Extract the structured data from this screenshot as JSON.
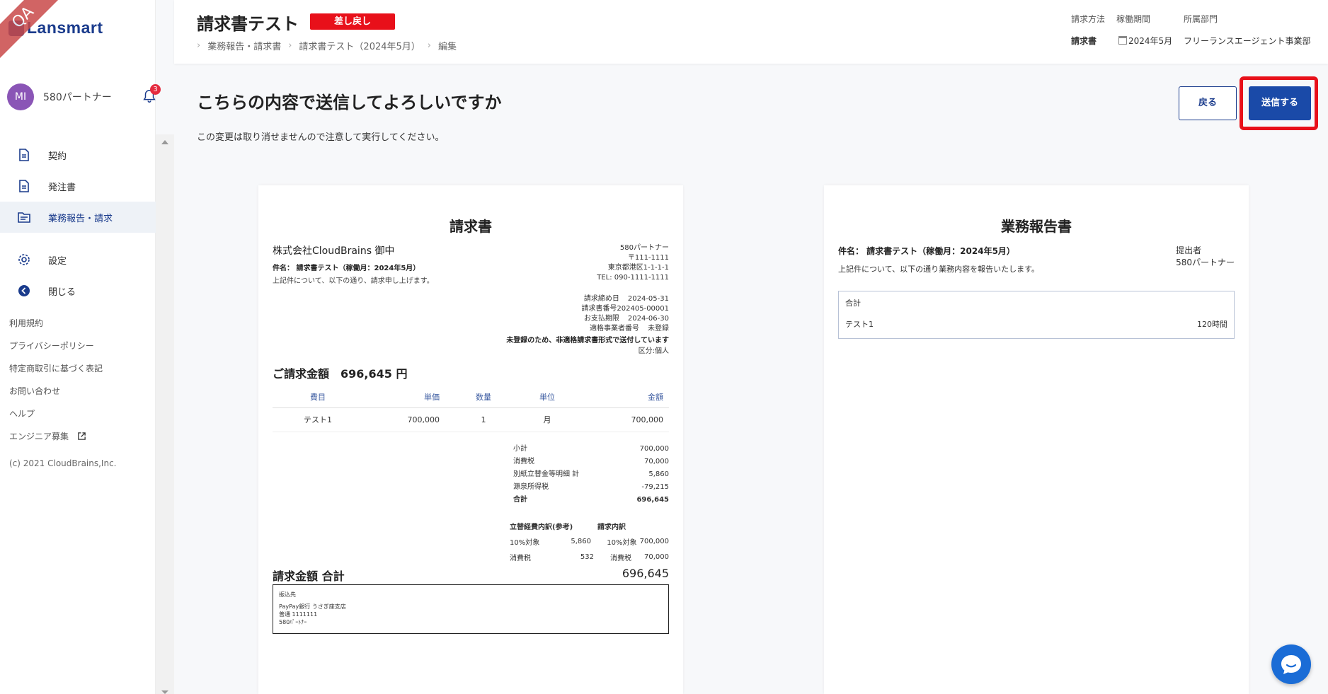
{
  "qa_ribbon": "QA",
  "logo": {
    "text": "Lansmart"
  },
  "user": {
    "initials": "MI",
    "name": "580パートナー",
    "notification_count": "3"
  },
  "sidebar": {
    "items": [
      {
        "label": "契約"
      },
      {
        "label": "発注書"
      },
      {
        "label": "業務報告・請求"
      },
      {
        "label": "設定"
      },
      {
        "label": "閉じる"
      }
    ],
    "footer_links": [
      "利用規約",
      "プライバシーポリシー",
      "特定商取引に基づく表記",
      "お問い合わせ",
      "ヘルプ",
      "エンジニア募集"
    ],
    "copyright": "(c) 2021 CloudBrains,Inc."
  },
  "header": {
    "title": "請求書テスト",
    "status": "差し戻し",
    "breadcrumb": [
      "業務報告・請求書",
      "請求書テスト（2024年5月）",
      "編集"
    ],
    "meta": {
      "billing_method_label": "請求方法",
      "billing_method_value": "請求書",
      "period_label": "稼働期間",
      "period_value": "2024年5月",
      "department_label": "所属部門",
      "department_value": "フリーランスエージェント事業部"
    }
  },
  "main": {
    "confirm_title": "こちらの内容で送信してよろしいですか",
    "confirm_note": "この変更は取り消せませんので注意して実行してください。",
    "back_label": "戻る",
    "send_label": "送信する"
  },
  "invoice": {
    "title": "請求書",
    "client": "株式会社CloudBrains 御中",
    "subject": "件名： 請求書テスト（稼働月：2024年5月）",
    "lead": "上記件について、以下の通り、請求申し上げます。",
    "issuer": [
      "580パートナー",
      "〒111-1111",
      "東京都港区1-1-1-1",
      "TEL: 090-1111-1111"
    ],
    "dates": [
      {
        "label": "請求締め日",
        "value": "2024-05-31"
      },
      {
        "label": "請求書番号",
        "value": "202405-00001"
      },
      {
        "label": "お支払期限",
        "value": "2024-06-30"
      },
      {
        "label": "適格事業者番号",
        "value": "未登録"
      }
    ],
    "unregistered_note": "未登録のため、非適格請求書形式で送付しています",
    "kubun": "区分:個人",
    "total_label": "ご請求金額",
    "total_amount": "696,645 円",
    "table": {
      "headers": [
        "費目",
        "単価",
        "数量",
        "単位",
        "金額"
      ],
      "rows": [
        [
          "テスト1",
          "700,000",
          "1",
          "月",
          "700,000"
        ]
      ]
    },
    "sums": [
      {
        "label": "小計",
        "value": "700,000"
      },
      {
        "label": "消費税",
        "value": "70,000"
      },
      {
        "label": "別紙立替金等明細 計",
        "value": "5,860"
      },
      {
        "label": "源泉所得税",
        "value": "-79,215"
      },
      {
        "label": "合計",
        "value": "696,645"
      }
    ],
    "breakdown": {
      "left_title": "立替経費内訳(参考)",
      "right_title": "請求内訳",
      "rows": [
        {
          "l1": "10%対象",
          "l2": "5,860",
          "r1": "10%対象",
          "r2": "700,000"
        },
        {
          "l1": "消費税",
          "l2": "532",
          "r1": "消費税",
          "r2": "70,000"
        }
      ]
    },
    "grand_label": "請求金額 合計",
    "grand_value": "696,645",
    "bank": [
      "振込先",
      "PayPay銀行 うさぎ座支店",
      "普通 1111111",
      "580ﾊﾟｰﾄﾅｰ"
    ]
  },
  "report": {
    "title": "業務報告書",
    "subject": "件名： 請求書テスト（稼働月：2024年5月）",
    "lead": "上記件について、以下の通り業務内容を報告いたします。",
    "submitter_label": "提出者",
    "submitter_name": "580パートナー",
    "box_title": "合計",
    "row_label": "テスト1",
    "row_value": "120時間"
  },
  "colors": {
    "brand": "#1a3b8c",
    "accent": "#1a4aa8",
    "danger": "#e8101a",
    "avatar": "#8a55b6"
  }
}
